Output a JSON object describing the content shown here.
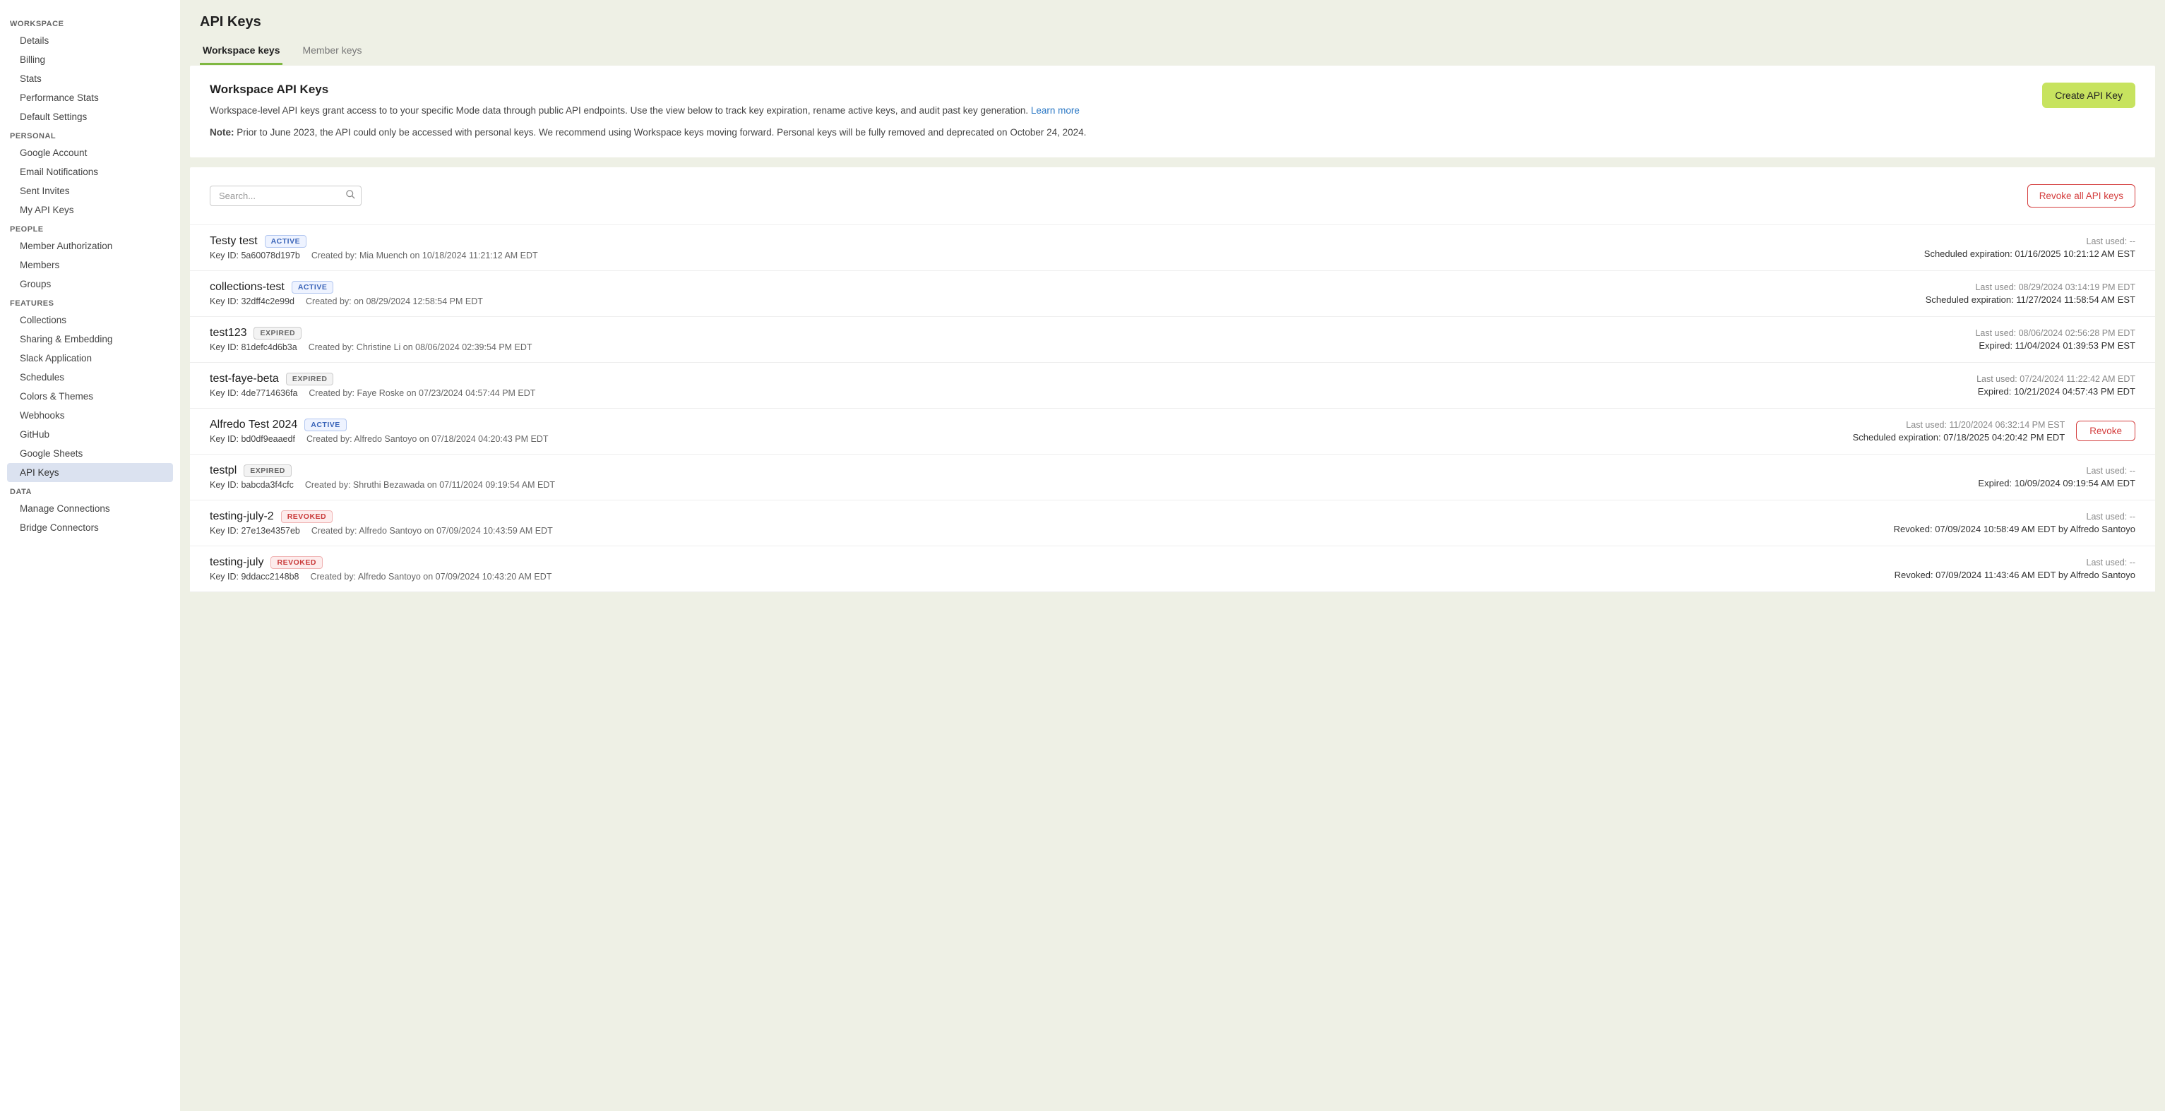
{
  "sidebar": {
    "sections": [
      {
        "title": "WORKSPACE",
        "items": [
          "Details",
          "Billing",
          "Stats",
          "Performance Stats",
          "Default Settings"
        ]
      },
      {
        "title": "PERSONAL",
        "items": [
          "Google Account",
          "Email Notifications",
          "Sent Invites",
          "My API Keys"
        ]
      },
      {
        "title": "PEOPLE",
        "items": [
          "Member Authorization",
          "Members",
          "Groups"
        ]
      },
      {
        "title": "FEATURES",
        "items": [
          "Collections",
          "Sharing & Embedding",
          "Slack Application",
          "Schedules",
          "Colors & Themes",
          "Webhooks",
          "GitHub",
          "Google Sheets",
          "API Keys"
        ]
      },
      {
        "title": "DATA",
        "items": [
          "Manage Connections",
          "Bridge Connectors"
        ]
      }
    ],
    "active": "API Keys"
  },
  "page": {
    "title": "API Keys"
  },
  "tabs": [
    {
      "label": "Workspace keys",
      "active": true
    },
    {
      "label": "Member keys",
      "active": false
    }
  ],
  "header": {
    "title": "Workspace API Keys",
    "desc_pre": "Workspace-level API keys grant access to to your specific Mode data through public API endpoints. Use the view below to track key expiration, rename active keys, and audit past key generation. ",
    "learn_more": "Learn more",
    "note_label": "Note:",
    "note_text": " Prior to June 2023, the API could only be accessed with personal keys. We recommend using Workspace keys moving forward. Personal keys will be fully removed and deprecated on October 24, 2024.",
    "create_btn": "Create API Key"
  },
  "toolbar": {
    "search_placeholder": "Search...",
    "revoke_all": "Revoke all API keys"
  },
  "key_id_label": "Key ID: ",
  "created_by_label": "Created by: ",
  "last_used_label": "Last used: ",
  "rows": [
    {
      "name": "Testy test",
      "status": "ACTIVE",
      "status_class": "active",
      "key_id": "5a60078d197b",
      "created_by": "Mia Muench on 10/18/2024 11:21:12 AM EDT",
      "last_used": "--",
      "line2": "Scheduled expiration: 01/16/2025 10:21:12 AM EST",
      "revokeBtn": false
    },
    {
      "name": "collections-test",
      "status": "ACTIVE",
      "status_class": "active",
      "key_id": "32dff4c2e99d",
      "created_by": "on 08/29/2024 12:58:54 PM EDT",
      "last_used": "08/29/2024 03:14:19 PM EDT",
      "line2": "Scheduled expiration: 11/27/2024 11:58:54 AM EST",
      "revokeBtn": false
    },
    {
      "name": "test123",
      "status": "EXPIRED",
      "status_class": "expired",
      "key_id": "81defc4d6b3a",
      "created_by": "Christine Li on 08/06/2024 02:39:54 PM EDT",
      "last_used": "08/06/2024 02:56:28 PM EDT",
      "line2": "Expired: 11/04/2024 01:39:53 PM EST",
      "revokeBtn": false
    },
    {
      "name": "test-faye-beta",
      "status": "EXPIRED",
      "status_class": "expired",
      "key_id": "4de7714636fa",
      "created_by": "Faye Roske on 07/23/2024 04:57:44 PM EDT",
      "last_used": "07/24/2024 11:22:42 AM EDT",
      "line2": "Expired: 10/21/2024 04:57:43 PM EDT",
      "revokeBtn": false
    },
    {
      "name": "Alfredo Test 2024",
      "status": "ACTIVE",
      "status_class": "active",
      "key_id": "bd0df9eaaedf",
      "created_by": "Alfredo Santoyo on 07/18/2024 04:20:43 PM EDT",
      "last_used": "11/20/2024 06:32:14 PM EST",
      "line2": "Scheduled expiration: 07/18/2025 04:20:42 PM EDT",
      "revokeBtn": true
    },
    {
      "name": "testpl",
      "status": "EXPIRED",
      "status_class": "expired",
      "key_id": "babcda3f4cfc",
      "created_by": "Shruthi Bezawada on 07/11/2024 09:19:54 AM EDT",
      "last_used": "--",
      "line2": "Expired: 10/09/2024 09:19:54 AM EDT",
      "revokeBtn": false
    },
    {
      "name": "testing-july-2",
      "status": "REVOKED",
      "status_class": "revoked",
      "key_id": "27e13e4357eb",
      "created_by": "Alfredo Santoyo on 07/09/2024 10:43:59 AM EDT",
      "last_used": "--",
      "line2": "Revoked: 07/09/2024 10:58:49 AM EDT by Alfredo Santoyo",
      "revokeBtn": false
    },
    {
      "name": "testing-july",
      "status": "REVOKED",
      "status_class": "revoked",
      "key_id": "9ddacc2148b8",
      "created_by": "Alfredo Santoyo on 07/09/2024 10:43:20 AM EDT",
      "last_used": "--",
      "line2": "Revoked: 07/09/2024 11:43:46 AM EDT by Alfredo Santoyo",
      "revokeBtn": false
    }
  ],
  "revoke_label": "Revoke"
}
